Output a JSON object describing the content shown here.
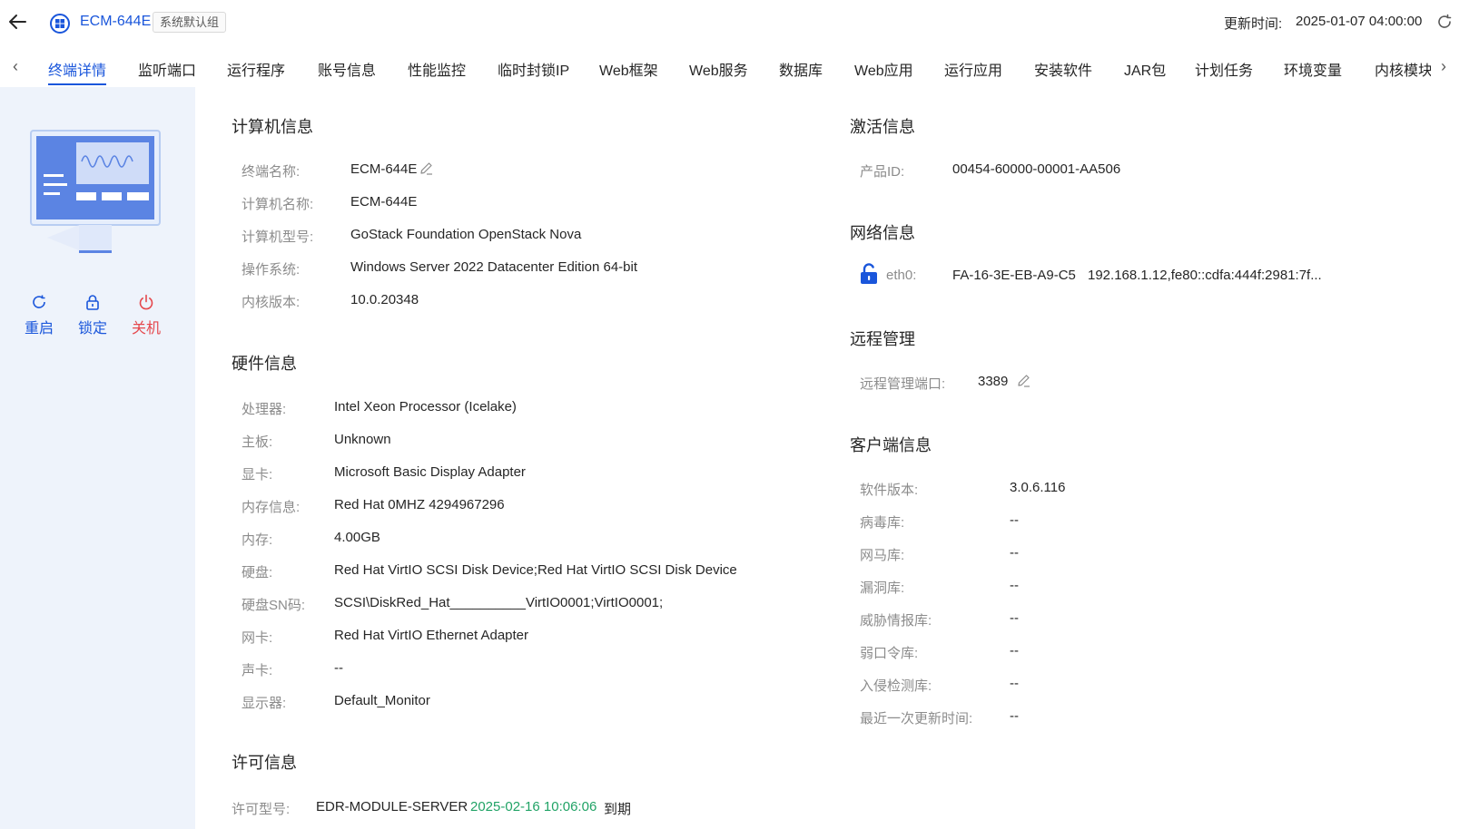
{
  "header": {
    "endpoint_name": "ECM-644E",
    "group_tag": "系统默认组",
    "update_label": "更新时间:",
    "update_time": "2025-01-07 04:00:00",
    "icons": [
      "back-arrow-icon",
      "windows-icon",
      "refresh-icon"
    ]
  },
  "tabs": [
    {
      "label": "终端详情",
      "active": true
    },
    {
      "label": "监听端口"
    },
    {
      "label": "运行程序"
    },
    {
      "label": "账号信息"
    },
    {
      "label": "性能监控"
    },
    {
      "label": "临时封锁IP"
    },
    {
      "label": "Web框架"
    },
    {
      "label": "Web服务"
    },
    {
      "label": "数据库"
    },
    {
      "label": "Web应用"
    },
    {
      "label": "运行应用"
    },
    {
      "label": "安装软件"
    },
    {
      "label": "JAR包"
    },
    {
      "label": "计划任务"
    },
    {
      "label": "环境变量"
    },
    {
      "label": "内核模块"
    }
  ],
  "actions": [
    {
      "label": "重启",
      "icon": "restart-icon",
      "color": "#1a56db"
    },
    {
      "label": "锁定",
      "icon": "lock-icon",
      "color": "#1a56db"
    },
    {
      "label": "关机",
      "icon": "power-icon",
      "color": "#e5484d"
    }
  ],
  "computer_info": {
    "title": "计算机信息",
    "items": [
      {
        "label": "终端名称:",
        "value": "ECM-644E"
      },
      {
        "label": "计算机名称:",
        "value": "ECM-644E"
      },
      {
        "label": "计算机型号:",
        "value": "GoStack Foundation OpenStack Nova"
      },
      {
        "label": "操作系统:",
        "value": "Windows Server 2022 Datacenter Edition 64-bit"
      },
      {
        "label": "内核版本:",
        "value": "10.0.20348"
      }
    ]
  },
  "hardware_info": {
    "title": "硬件信息",
    "items": [
      {
        "label": "处理器:",
        "value": "Intel Xeon Processor (Icelake)"
      },
      {
        "label": "主板:",
        "value": "Unknown"
      },
      {
        "label": "显卡:",
        "value": "Microsoft Basic Display Adapter"
      },
      {
        "label": "内存信息:",
        "value": "Red Hat 0MHZ 4294967296"
      },
      {
        "label": "内存:",
        "value": "4.00GB"
      },
      {
        "label": "硬盘:",
        "value": "Red Hat VirtIO SCSI Disk Device;Red Hat VirtIO SCSI Disk Device"
      },
      {
        "label": "硬盘SN码:",
        "value": "SCSI\\DiskRed_Hat__________VirtIO0001;VirtIO0001;"
      },
      {
        "label": "网卡:",
        "value": "Red Hat VirtIO Ethernet Adapter"
      },
      {
        "label": "声卡:",
        "value": "--"
      },
      {
        "label": "显示器:",
        "value": "Default_Monitor"
      }
    ]
  },
  "license_info": {
    "title": "许可信息",
    "label": "许可型号:",
    "model": "EDR-MODULE-SERVER",
    "expire_date": "2025-02-16 10:06:06",
    "expire_suffix": "到期"
  },
  "activation_info": {
    "title": "激活信息",
    "label": "产品ID:",
    "value": "00454-60000-00001-AA506"
  },
  "network_info": {
    "title": "网络信息",
    "label": "eth0:",
    "mac": "FA-16-3E-EB-A9-C5",
    "ip": "192.168.1.12,fe80::cdfa:444f:2981:7f..."
  },
  "remote_mgmt": {
    "title": "远程管理",
    "label": "远程管理端口:",
    "value": "3389"
  },
  "client_info": {
    "title": "客户端信息",
    "items": [
      {
        "label": "软件版本:",
        "value": "3.0.6.116"
      },
      {
        "label": "病毒库:",
        "value": "--"
      },
      {
        "label": "网马库:",
        "value": "--"
      },
      {
        "label": "漏洞库:",
        "value": "--"
      },
      {
        "label": "威胁情报库:",
        "value": "--"
      },
      {
        "label": "弱口令库:",
        "value": "--"
      },
      {
        "label": "入侵检测库:",
        "value": "--"
      },
      {
        "label": "最近一次更新时间:",
        "value": "--"
      }
    ]
  },
  "colors": {
    "accent": "#1a56db",
    "danger": "#e5484d",
    "success": "#21a366",
    "panel_bg": "#eef3fb"
  }
}
